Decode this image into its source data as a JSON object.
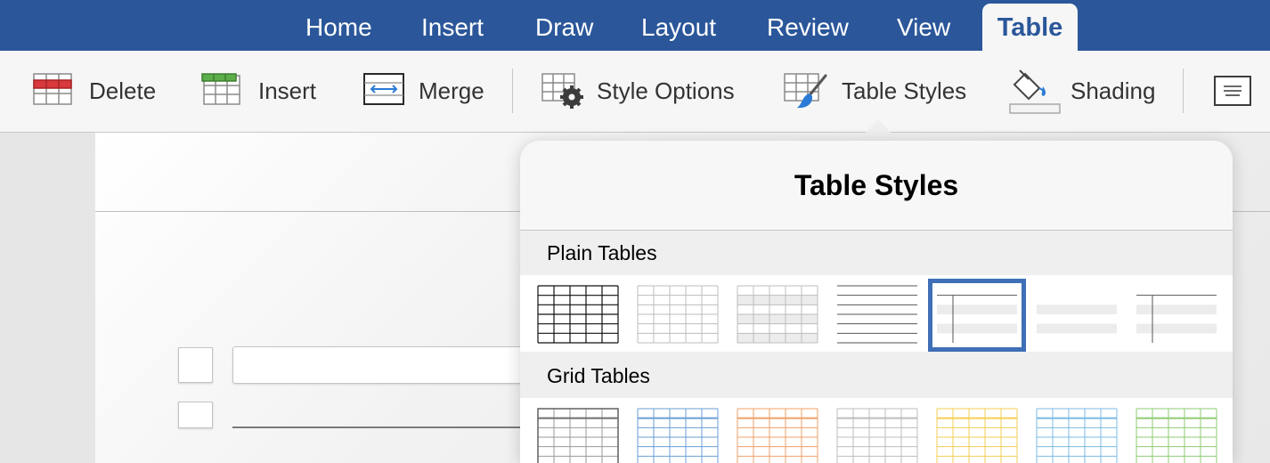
{
  "tabs": [
    {
      "label": "Home",
      "active": false
    },
    {
      "label": "Insert",
      "active": false
    },
    {
      "label": "Draw",
      "active": false
    },
    {
      "label": "Layout",
      "active": false
    },
    {
      "label": "Review",
      "active": false
    },
    {
      "label": "View",
      "active": false
    },
    {
      "label": "Table",
      "active": true
    }
  ],
  "ribbon": {
    "delete_label": "Delete",
    "insert_label": "Insert",
    "merge_label": "Merge",
    "style_options_label": "Style Options",
    "table_styles_label": "Table Styles",
    "shading_label": "Shading"
  },
  "popover": {
    "title": "Table Styles",
    "sections": [
      {
        "label": "Plain Tables",
        "selected_index": 4
      },
      {
        "label": "Grid Tables"
      }
    ]
  },
  "colors": {
    "tab_bar": "#2b579a",
    "accent": "#3f6fb6",
    "delete_red": "#d9393c",
    "insert_green": "#5cae4b",
    "grid_accents": [
      "#6e6e6e",
      "#6a9fd6",
      "#f0a06a",
      "#bdbdbd",
      "#f3cf55",
      "#7bbbe3",
      "#8fcb74"
    ]
  }
}
